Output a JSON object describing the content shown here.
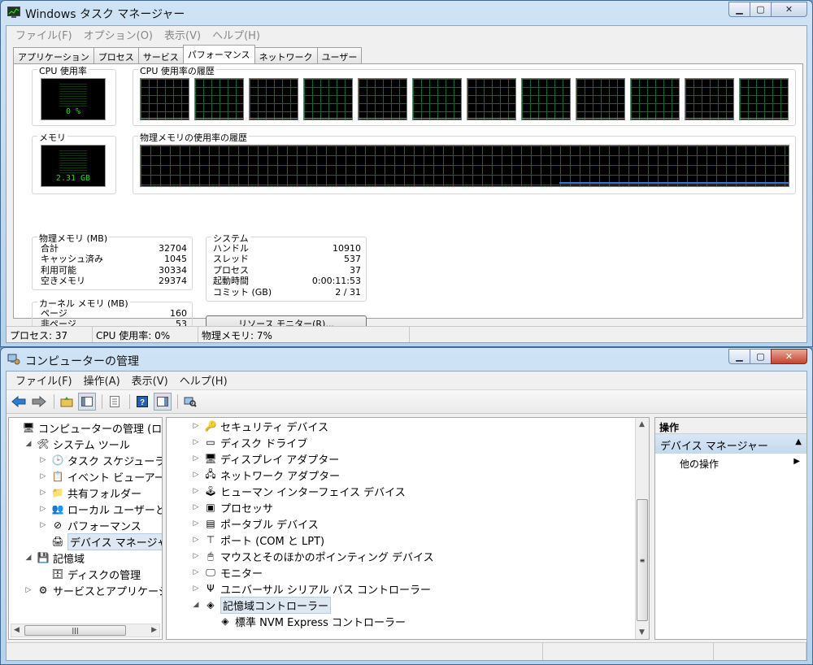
{
  "task_manager": {
    "title": "Windows タスク マネージャー",
    "menu": [
      "ファイル(F)",
      "オプション(O)",
      "表示(V)",
      "ヘルプ(H)"
    ],
    "tabs": [
      "アプリケーション",
      "プロセス",
      "サービス",
      "パフォーマンス",
      "ネットワーク",
      "ユーザー"
    ],
    "active_tab": "パフォーマンス",
    "cpu_usage_label": "CPU 使用率",
    "cpu_usage_value": "0 %",
    "cpu_history_label": "CPU 使用率の履歴",
    "cpu_core_count": 12,
    "memory_label": "メモリ",
    "memory_value": "2.31 GB",
    "memory_history_label": "物理メモリの使用率の履歴",
    "physical_memory": {
      "title": "物理メモリ (MB)",
      "rows": [
        {
          "label": "合計",
          "value": "32704"
        },
        {
          "label": "キャッシュ済み",
          "value": "1045"
        },
        {
          "label": "利用可能",
          "value": "30334"
        },
        {
          "label": "空きメモリ",
          "value": "29374"
        }
      ]
    },
    "kernel_memory": {
      "title": "カーネル メモリ (MB)",
      "rows": [
        {
          "label": "ページ",
          "value": "160"
        },
        {
          "label": "非ページ",
          "value": "53"
        }
      ]
    },
    "system": {
      "title": "システム",
      "rows": [
        {
          "label": "ハンドル",
          "value": "10910"
        },
        {
          "label": "スレッド",
          "value": "537"
        },
        {
          "label": "プロセス",
          "value": "37"
        },
        {
          "label": "起動時間",
          "value": "0:00:11:53"
        },
        {
          "label": "コミット (GB)",
          "value": "2 / 31"
        }
      ]
    },
    "resource_monitor_button": "リソース モニター(R)...",
    "status": {
      "processes": "プロセス: 37",
      "cpu": "CPU 使用率: 0%",
      "memory": "物理メモリ: 7%"
    },
    "colors": {
      "graph_line": "#1ee01e",
      "grid": "#0b6b2b",
      "memory_line": "#3a7bd5"
    }
  },
  "computer_management": {
    "title": "コンピューターの管理",
    "menu": [
      "ファイル(F)",
      "操作(A)",
      "表示(V)",
      "ヘルプ(H)"
    ],
    "toolbar_icons": [
      "back-icon",
      "forward-icon",
      "up-folder-icon",
      "show-tree-icon",
      "properties-icon",
      "help-icon",
      "show-action-pane-icon",
      "scan-hardware-icon"
    ],
    "left_tree": [
      {
        "label": "コンピューターの管理 (ローカ",
        "indent": 0,
        "expander": "",
        "icon": "computer-management-icon"
      },
      {
        "label": "システム ツール",
        "indent": 1,
        "expander": "◢",
        "icon": "system-tools-icon"
      },
      {
        "label": "タスク スケジューラ",
        "indent": 2,
        "expander": "▷",
        "icon": "task-scheduler-icon"
      },
      {
        "label": "イベント ビューアー",
        "indent": 2,
        "expander": "▷",
        "icon": "event-viewer-icon"
      },
      {
        "label": "共有フォルダー",
        "indent": 2,
        "expander": "▷",
        "icon": "shared-folders-icon"
      },
      {
        "label": "ローカル ユーザーとグ",
        "indent": 2,
        "expander": "▷",
        "icon": "local-users-icon"
      },
      {
        "label": "パフォーマンス",
        "indent": 2,
        "expander": "▷",
        "icon": "performance-icon"
      },
      {
        "label": "デバイス マネージャー",
        "indent": 2,
        "expander": "",
        "icon": "device-manager-icon",
        "selected": true
      },
      {
        "label": "記憶域",
        "indent": 1,
        "expander": "◢",
        "icon": "storage-icon"
      },
      {
        "label": "ディスクの管理",
        "indent": 2,
        "expander": "",
        "icon": "disk-management-icon"
      },
      {
        "label": "サービスとアプリケーショ",
        "indent": 1,
        "expander": "▷",
        "icon": "services-apps-icon"
      }
    ],
    "device_tree": [
      {
        "label": "セキュリティ デバイス",
        "indent": 1,
        "expander": "▷",
        "icon": "security-device-icon"
      },
      {
        "label": "ディスク ドライブ",
        "indent": 1,
        "expander": "▷",
        "icon": "disk-drive-icon"
      },
      {
        "label": "ディスプレイ アダプター",
        "indent": 1,
        "expander": "▷",
        "icon": "display-adapter-icon"
      },
      {
        "label": "ネットワーク アダプター",
        "indent": 1,
        "expander": "▷",
        "icon": "network-adapter-icon"
      },
      {
        "label": "ヒューマン インターフェイス デバイス",
        "indent": 1,
        "expander": "▷",
        "icon": "hid-icon"
      },
      {
        "label": "プロセッサ",
        "indent": 1,
        "expander": "▷",
        "icon": "processor-icon"
      },
      {
        "label": "ポータブル デバイス",
        "indent": 1,
        "expander": "▷",
        "icon": "portable-device-icon"
      },
      {
        "label": "ポート (COM と LPT)",
        "indent": 1,
        "expander": "▷",
        "icon": "port-icon"
      },
      {
        "label": "マウスとそのほかのポインティング デバイス",
        "indent": 1,
        "expander": "▷",
        "icon": "mouse-icon"
      },
      {
        "label": "モニター",
        "indent": 1,
        "expander": "▷",
        "icon": "monitor-icon"
      },
      {
        "label": "ユニバーサル シリアル バス コントローラー",
        "indent": 1,
        "expander": "▷",
        "icon": "usb-icon"
      },
      {
        "label": "記憶域コントローラー",
        "indent": 1,
        "expander": "◢",
        "icon": "storage-controller-icon",
        "selected": true
      },
      {
        "label": "標準 NVM Express コントローラー",
        "indent": 2,
        "expander": "",
        "icon": "nvme-controller-icon"
      }
    ],
    "actions": {
      "header": "操作",
      "section": "デバイス マネージャー",
      "item": "他の操作"
    }
  }
}
